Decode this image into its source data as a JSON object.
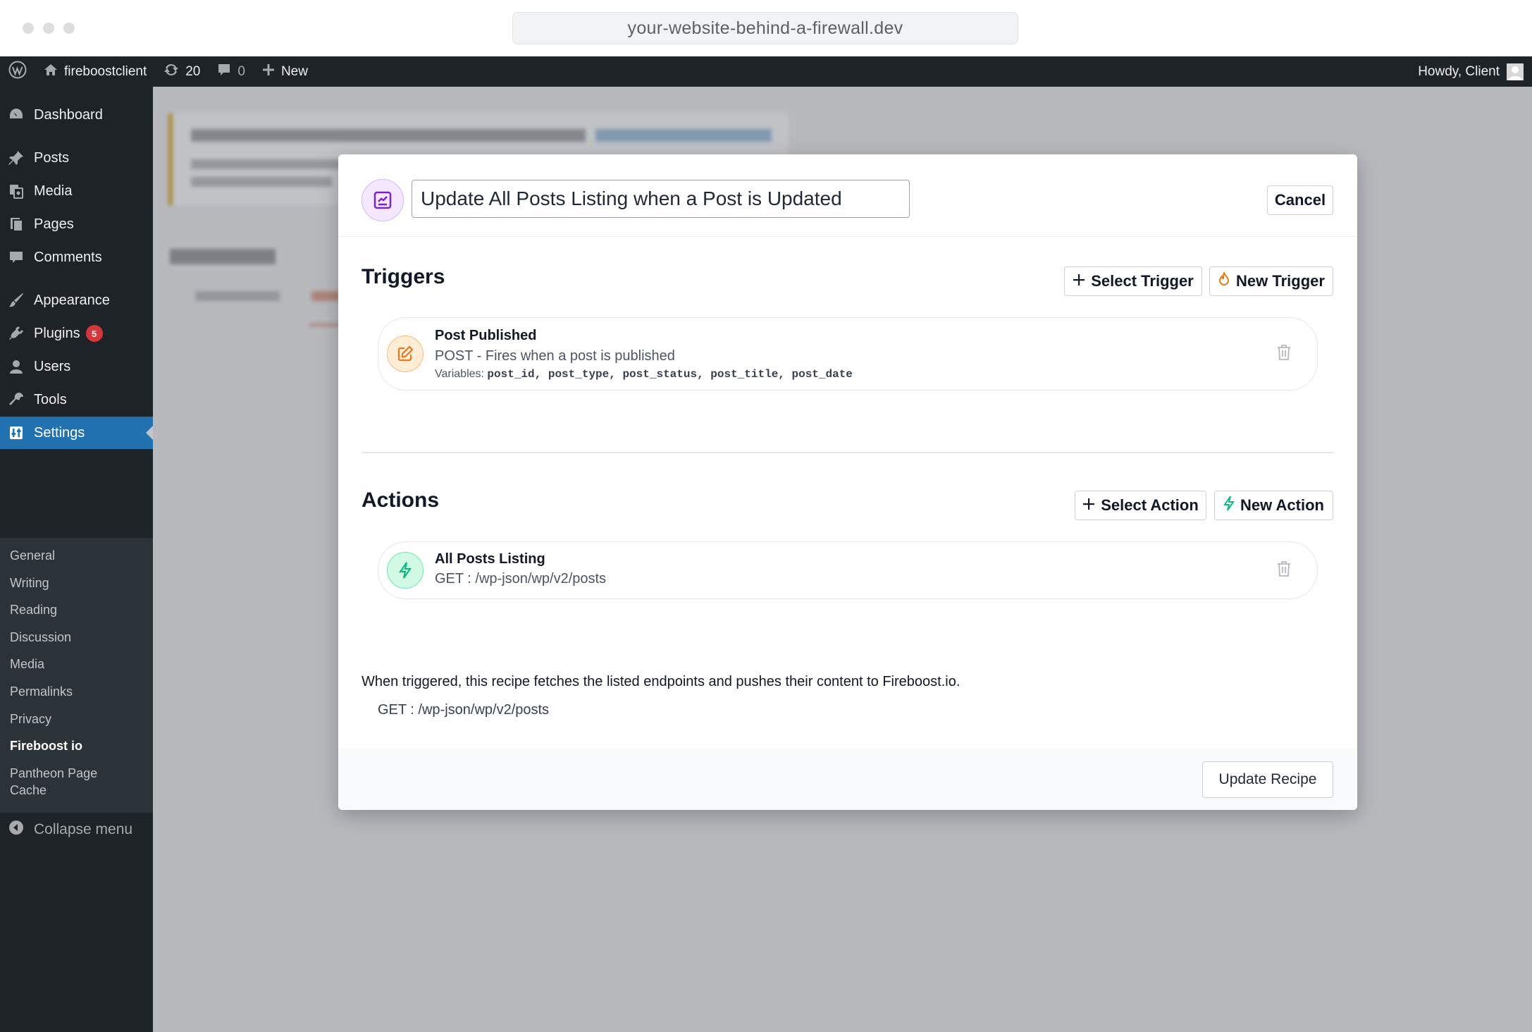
{
  "browser": {
    "url": "your-website-behind-a-firewall.dev"
  },
  "adminbar": {
    "site_name": "fireboostclient",
    "updates_count": "20",
    "comments_count": "0",
    "new_label": "New",
    "howdy": "Howdy, Client"
  },
  "sidebar": {
    "items": [
      {
        "label": "Dashboard",
        "icon": "dashboard-icon"
      },
      {
        "label": "Posts",
        "icon": "pin-icon"
      },
      {
        "label": "Media",
        "icon": "media-icon"
      },
      {
        "label": "Pages",
        "icon": "pages-icon"
      },
      {
        "label": "Comments",
        "icon": "comment-icon"
      },
      {
        "label": "Appearance",
        "icon": "brush-icon"
      },
      {
        "label": "Plugins",
        "icon": "plugin-icon",
        "badge": "5"
      },
      {
        "label": "Users",
        "icon": "user-icon"
      },
      {
        "label": "Tools",
        "icon": "wrench-icon"
      },
      {
        "label": "Settings",
        "icon": "settings-icon",
        "current": true
      }
    ],
    "submenu": [
      "General",
      "Writing",
      "Reading",
      "Discussion",
      "Media",
      "Permalinks",
      "Privacy",
      "Fireboost io",
      "Pantheon Page Cache"
    ],
    "active_submenu": "Fireboost io",
    "collapse_label": "Collapse menu"
  },
  "modal": {
    "title_value": "Update All Posts Listing when a Post is Updated",
    "cancel_label": "Cancel",
    "triggers": {
      "heading": "Triggers",
      "select_label": "Select Trigger",
      "new_label": "New Trigger",
      "items": [
        {
          "title": "Post Published",
          "subtitle": "POST - Fires when a post is published",
          "variables_label": "Variables:",
          "variables": "post_id, post_type, post_status, post_title, post_date"
        }
      ]
    },
    "actions": {
      "heading": "Actions",
      "select_label": "Select Action",
      "new_label": "New Action",
      "items": [
        {
          "title": "All Posts Listing",
          "subtitle": "GET : /wp-json/wp/v2/posts"
        }
      ]
    },
    "summary_text": "When triggered, this recipe fetches the listed endpoints and pushes their content to Fireboost.io.",
    "summary_endpoints": [
      "GET : /wp-json/wp/v2/posts"
    ],
    "update_label": "Update Recipe"
  },
  "colors": {
    "wp_dark": "#1d2327",
    "wp_blue": "#2271b1",
    "trigger_accent": "#ea7a1a",
    "action_accent": "#10b981",
    "recipe_accent": "#7e22ce"
  }
}
